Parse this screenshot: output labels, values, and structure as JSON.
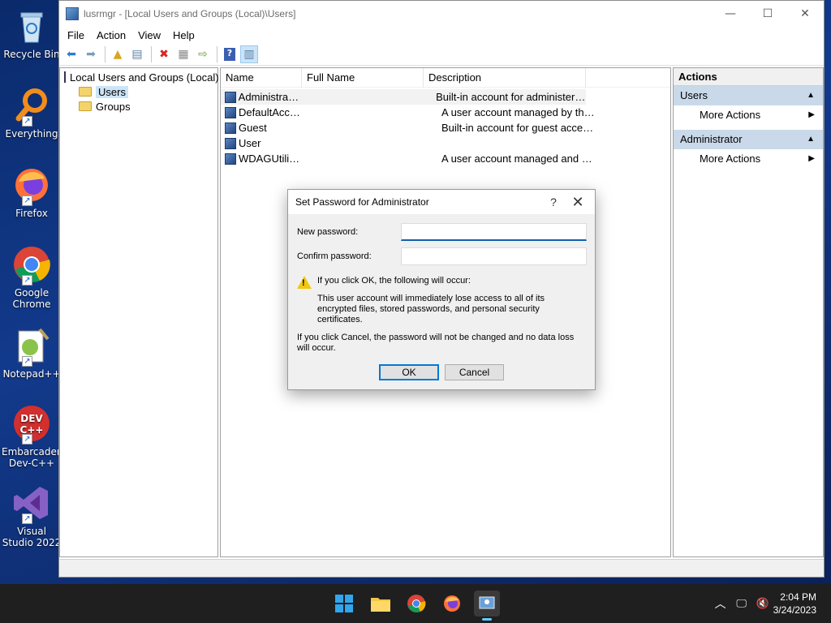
{
  "desktop": {
    "icons": [
      {
        "label": "Recycle Bin",
        "icon": "recycle-bin-icon"
      },
      {
        "label": "Everything",
        "icon": "search-magnifier-icon"
      },
      {
        "label": "Firefox",
        "icon": "firefox-icon"
      },
      {
        "label": "Google Chrome",
        "icon": "chrome-icon"
      },
      {
        "label": "Notepad++",
        "icon": "notepad-plus-plus-icon"
      },
      {
        "label": "Embarcadero Dev-C++",
        "icon": "dev-cpp-icon"
      },
      {
        "label": "Visual Studio 2022",
        "icon": "visual-studio-icon"
      }
    ]
  },
  "window": {
    "title": "lusrmgr - [Local Users and Groups (Local)\\Users]",
    "controls": {
      "minimize": "—",
      "maximize": "☐",
      "close": "✕"
    }
  },
  "menu": [
    "File",
    "Action",
    "View",
    "Help"
  ],
  "tree": {
    "root": "Local Users and Groups (Local)",
    "children": [
      "Users",
      "Groups"
    ],
    "selected": "Users"
  },
  "list": {
    "columns": [
      "Name",
      "Full Name",
      "Description"
    ],
    "rows": [
      {
        "name": "Administrator",
        "full_name": "",
        "description": "Built-in account for administering..."
      },
      {
        "name": "DefaultAcco...",
        "full_name": "",
        "description": "A user account managed by the s..."
      },
      {
        "name": "Guest",
        "full_name": "",
        "description": "Built-in account for guest access t..."
      },
      {
        "name": "User",
        "full_name": "",
        "description": ""
      },
      {
        "name": "WDAGUtility...",
        "full_name": "",
        "description": "A user account managed and use..."
      }
    ]
  },
  "actions": {
    "header": "Actions",
    "groups": [
      {
        "title": "Users",
        "items": [
          "More Actions"
        ]
      },
      {
        "title": "Administrator",
        "items": [
          "More Actions"
        ]
      }
    ]
  },
  "dialog": {
    "title": "Set Password for Administrator",
    "help": "?",
    "close": "✕",
    "new_password_label": "New password:",
    "confirm_password_label": "Confirm password:",
    "new_password_value": "",
    "confirm_password_value": "",
    "warning_heading": "If you click OK, the following will occur:",
    "warning_body": "This user account will immediately lose access to all of its encrypted files, stored passwords, and personal security certificates.",
    "cancel_note": "If you click Cancel, the password will not be changed and no data loss will occur.",
    "ok_label": "OK",
    "cancel_label": "Cancel"
  },
  "taskbar": {
    "apps": [
      "start-icon",
      "file-explorer-icon",
      "chrome-icon",
      "firefox-icon",
      "lusrmgr-icon"
    ],
    "time": "2:04 PM",
    "date": "3/24/2023"
  },
  "colors": {
    "accent": "#0078d7",
    "selection": "#cce4f7",
    "actions_group": "#c9d9ea",
    "warning": "#f2c811"
  }
}
